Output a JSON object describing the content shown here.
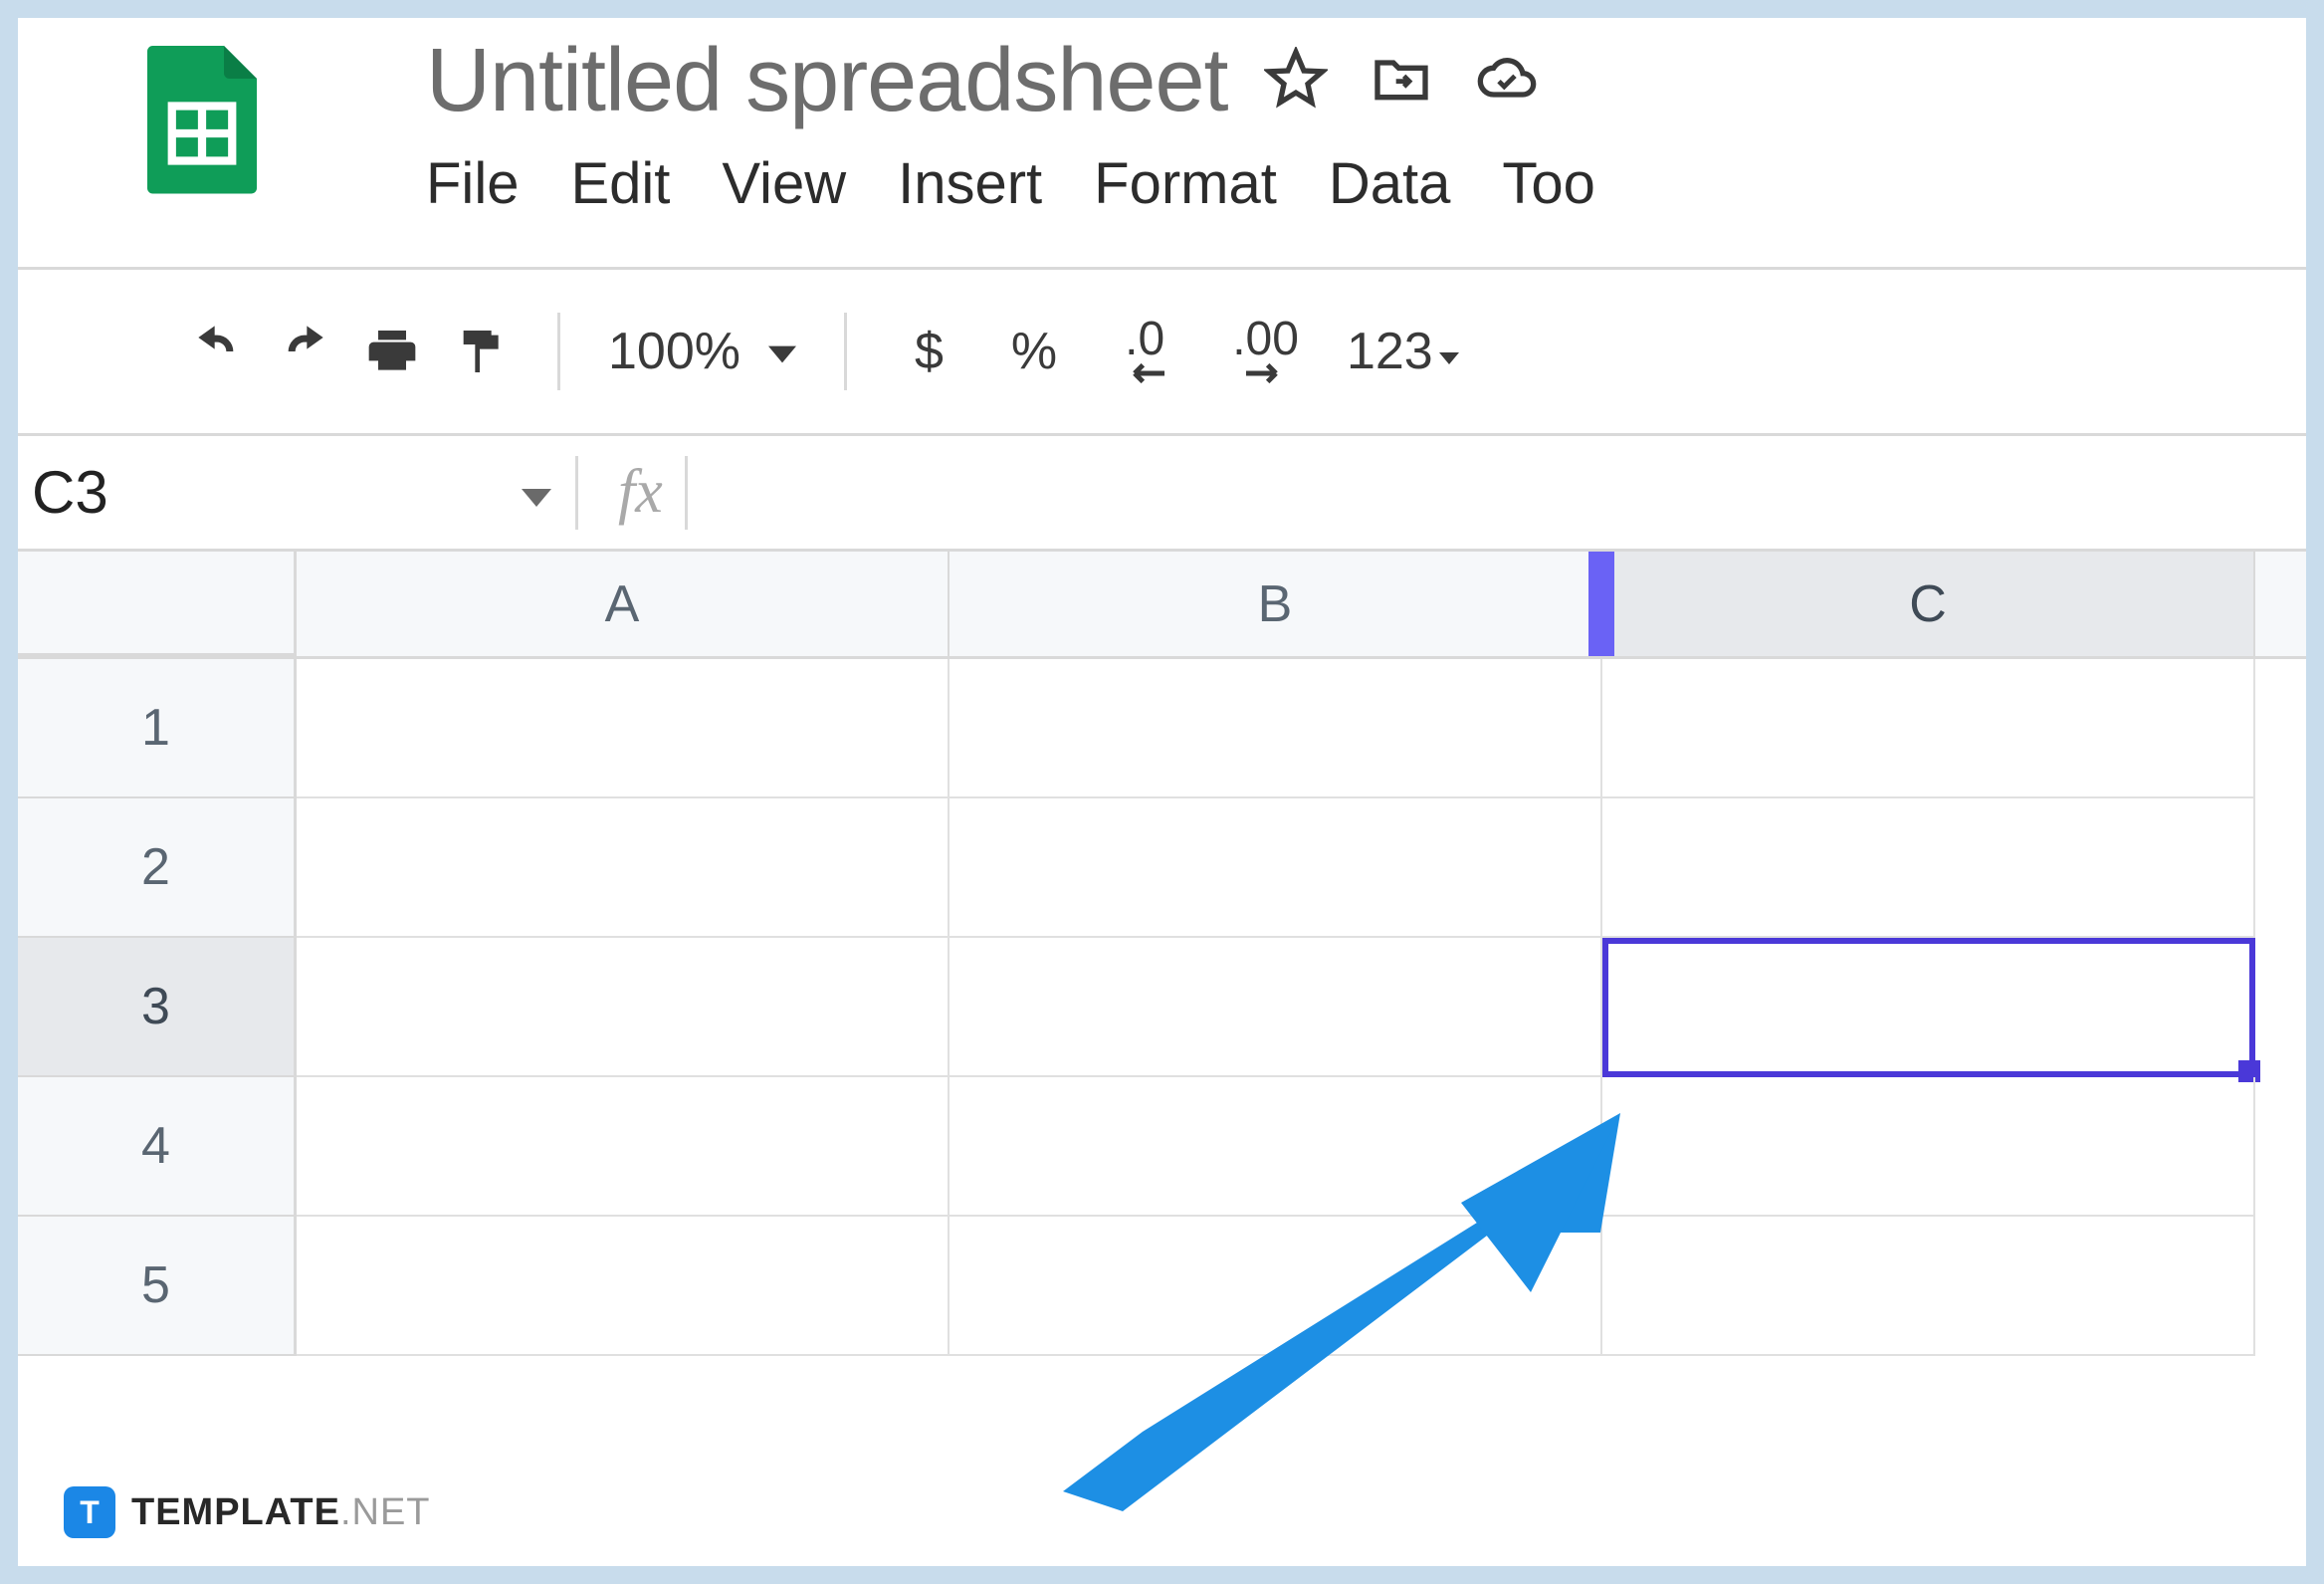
{
  "header": {
    "title": "Untitled spreadsheet",
    "menu": [
      "File",
      "Edit",
      "View",
      "Insert",
      "Format",
      "Data",
      "Too"
    ]
  },
  "toolbar": {
    "zoom": "100%",
    "currency": "$",
    "percent": "%",
    "dec_decrease": ".0",
    "dec_increase": ".00",
    "number_format": "123"
  },
  "fxbar": {
    "namebox": "C3",
    "fx_label": "fx"
  },
  "grid": {
    "columns": [
      "A",
      "B",
      "C"
    ],
    "active_column": "C",
    "rows": [
      "1",
      "2",
      "3",
      "4",
      "5"
    ],
    "active_row": "3",
    "selected_cell": "C3"
  },
  "watermark": {
    "badge": "T",
    "brand": "TEMPLATE",
    "suffix": ".NET"
  }
}
